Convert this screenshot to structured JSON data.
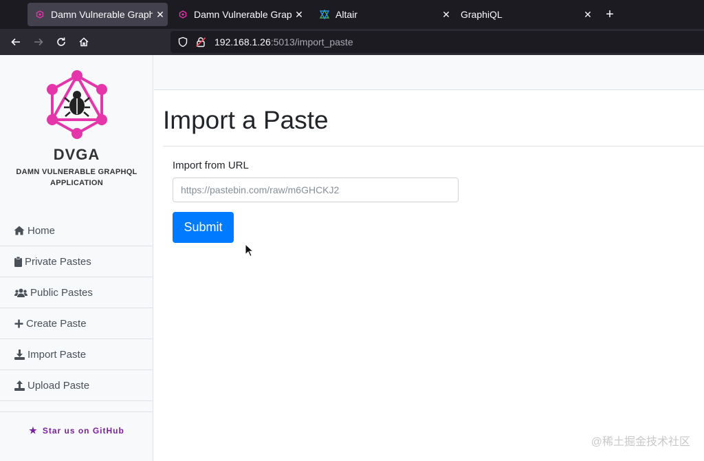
{
  "browser": {
    "tabs": [
      {
        "title": "Damn Vulnerable GraphQ",
        "close": "✕"
      },
      {
        "title": "Damn Vulnerable GraphQ",
        "close": "✕"
      },
      {
        "title": "Altair",
        "close": "✕"
      },
      {
        "title": "GraphiQL",
        "close": "✕"
      }
    ],
    "new_tab": "+",
    "url_host": "192.168.1.26",
    "url_rest": ":5013/import_paste"
  },
  "sidebar": {
    "brand": "DVGA",
    "brand_sub_line1": "DAMN VULNERABLE GRAPHQL",
    "brand_sub_line2": "APPLICATION",
    "items": [
      {
        "label": "Home",
        "icon": "home-icon"
      },
      {
        "label": "Private Pastes",
        "icon": "clipboard-icon"
      },
      {
        "label": "Public Pastes",
        "icon": "users-icon"
      },
      {
        "label": "Create Paste",
        "icon": "plus-icon"
      },
      {
        "label": "Import Paste",
        "icon": "download-icon"
      },
      {
        "label": "Upload Paste",
        "icon": "upload-icon"
      }
    ],
    "github": "Star us on GitHub"
  },
  "main": {
    "title": "Import a Paste",
    "field_label": "Import from URL",
    "placeholder": "https://pastebin.com/raw/m6GHCKJ2",
    "submit": "Submit"
  },
  "watermark": "@稀土掘金技术社区",
  "colors": {
    "accent": "#007bff",
    "logo_pink": "#e535ab",
    "github_purple": "#7b1fa2"
  }
}
